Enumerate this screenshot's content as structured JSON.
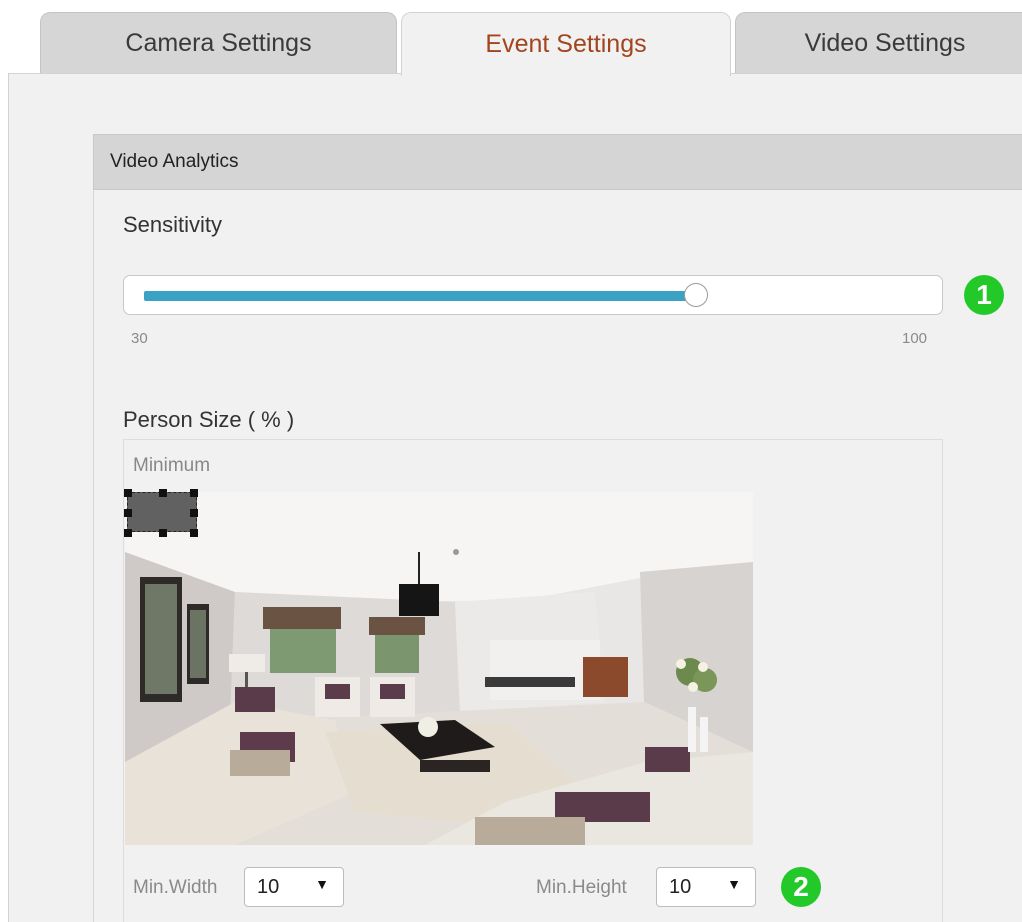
{
  "tabs": {
    "camera_settings": "Camera Settings",
    "event_settings": "Event Settings",
    "video_settings": "Video Settings"
  },
  "panel": {
    "title": "Video Analytics"
  },
  "sensitivity": {
    "heading": "Sensitivity",
    "min_label": "30",
    "max_label": "100",
    "value_fraction": 0.69
  },
  "person_size": {
    "heading": "Person Size ( % )",
    "minimum_label": "Minimum",
    "min_width_label": "Min.Width",
    "min_width_value": "10",
    "min_height_label": "Min.Height",
    "min_height_value": "10"
  },
  "callouts": {
    "one": "1",
    "two": "2"
  },
  "colors": {
    "active_tab_text": "#a2451d",
    "slider_fill": "#3aa2c4",
    "callout_badge": "#23c928"
  },
  "icons": {
    "dropdown": "dropdown-arrow-icon"
  }
}
